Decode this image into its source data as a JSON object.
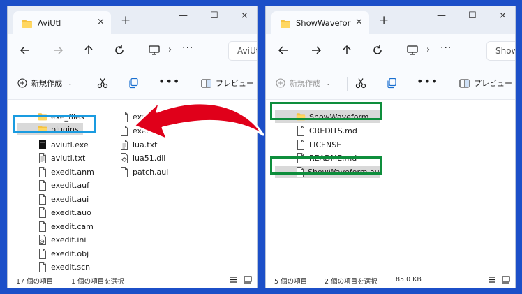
{
  "left_window": {
    "tab_title": "AviUtl",
    "breadcrumb": "AviUtl",
    "toolbar": {
      "new_label": "新規作成",
      "preview_label": "プレビュー"
    },
    "files_col1": [
      "exe_files",
      "plugins",
      "aviutl.exe",
      "aviutl.txt",
      "exedit.anm",
      "exedit.auf",
      "exedit.aui",
      "exedit.auo",
      "exedit.cam",
      "exedit.ini",
      "exedit.obj",
      "exedit.scn"
    ],
    "files_col2": [
      "exedi",
      "exedi",
      "lua.txt",
      "lua51.dll",
      "patch.aul"
    ],
    "status": {
      "count": "17 個の項目",
      "selected": "1 個の項目を選択"
    }
  },
  "right_window": {
    "tab_title": "ShowWavefor",
    "breadcrumb": "Show",
    "toolbar": {
      "new_label": "新規作成",
      "preview_label": "プレビュー"
    },
    "files": [
      "ShowWaveform",
      "CREDITS.md",
      "LICENSE",
      "README.md",
      "ShowWaveform.auf"
    ],
    "status": {
      "count": "5 個の項目",
      "selected": "2 個の項目を選択",
      "size": "85.0 KB"
    }
  },
  "common": {
    "close_glyph": "×",
    "new_tab_glyph": "+",
    "minimize_glyph": "—",
    "maximize_glyph": "☐",
    "chevron_glyph": "›",
    "more_glyph": "···",
    "toolbar_more_glyph": "•••",
    "dropdown_glyph": "⌄"
  },
  "colors": {
    "desktop": "#1c4fc8",
    "highlight_blue": "#1a9be0",
    "highlight_green": "#0e8e3c",
    "arrow_red": "#e0001a",
    "folder_yellow": "#f5c242"
  }
}
